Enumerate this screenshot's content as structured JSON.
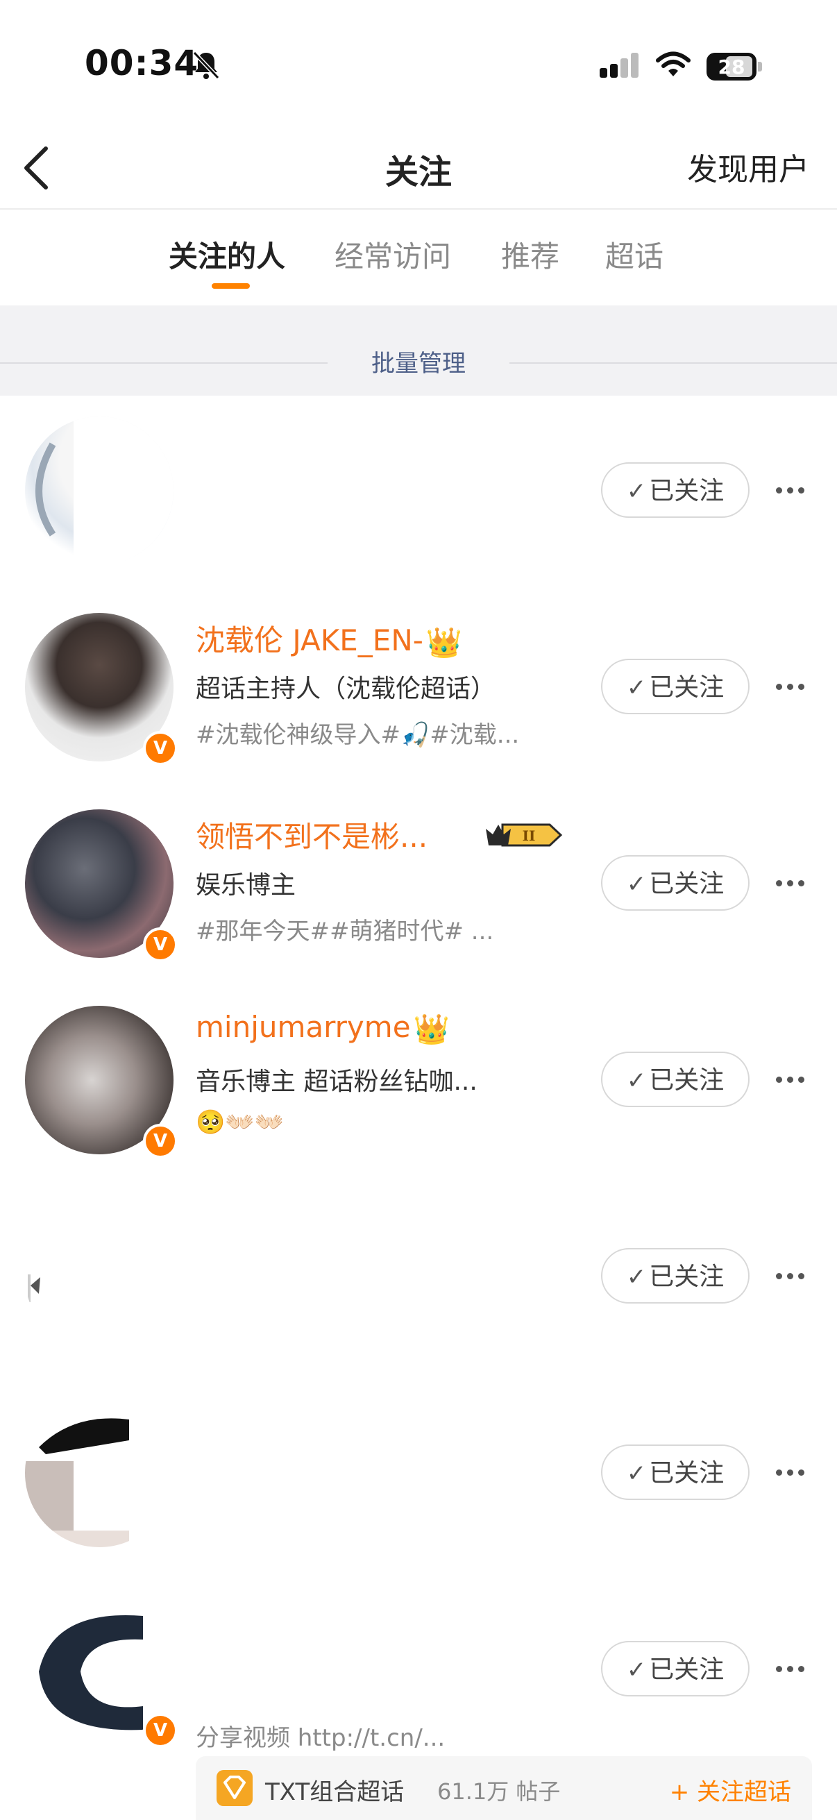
{
  "status": {
    "time": "00:34",
    "battery": "28"
  },
  "nav": {
    "title": "关注",
    "right_action": "发现用户"
  },
  "tabs": [
    {
      "label": "关注的人",
      "active": true
    },
    {
      "label": "经常访问",
      "active": false
    },
    {
      "label": "推荐",
      "active": false
    },
    {
      "label": "超话",
      "active": false
    }
  ],
  "batch_manage": "批量管理",
  "follow_label": "已关注",
  "rows": [
    {
      "name": "",
      "desc": "",
      "tags": "",
      "verified": false
    },
    {
      "name": "沈载伦 JAKE_EN-",
      "desc": "超话主持人（沈载伦超话）",
      "tags": "#沈载伦神级导入#🎣#沈载...",
      "verified": true
    },
    {
      "name": "领悟不到不是彬...",
      "desc": "娱乐博主",
      "tags": "#那年今天##萌猪时代# ...",
      "verified": true,
      "level": "II"
    },
    {
      "name": "minjumarryme",
      "desc": "音乐博主 超话粉丝钻咖...",
      "tags": "🥺👐🏻👐🏻",
      "verified": true
    },
    {
      "name": "",
      "desc": "",
      "tags": "",
      "verified": false
    },
    {
      "name": "",
      "desc": "",
      "tags": "",
      "verified": true
    },
    {
      "name": "",
      "desc": "",
      "tags": "分享视频 http://t.cn/...",
      "verified": true
    }
  ],
  "bottom_bar": {
    "title": "TXT组合超话",
    "count": "61.1万 帖子",
    "action": "+ 关注超话"
  },
  "colors": {
    "accent": "#ff8200",
    "name": "#f2711c",
    "batch_text": "#4d5f88"
  }
}
